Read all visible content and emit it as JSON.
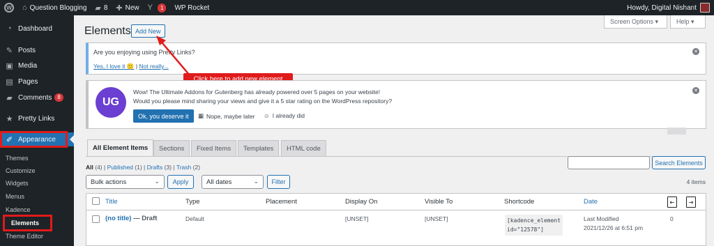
{
  "admin_bar": {
    "site_name": "Question Blogging",
    "comments_count": "8",
    "new_label": "New",
    "yoast_badge": "1",
    "wp_rocket": "WP Rocket",
    "howdy": "Howdy, Digital Nishant"
  },
  "sidebar": {
    "dashboard": "Dashboard",
    "posts": "Posts",
    "media": "Media",
    "pages": "Pages",
    "comments": "Comments",
    "comments_badge": "8",
    "pretty_links": "Pretty Links",
    "appearance": "Appearance",
    "sub": [
      "Themes",
      "Customize",
      "Widgets",
      "Menus",
      "Kadence",
      "Elements",
      "Theme Editor"
    ]
  },
  "screen_options": "Screen Options ▾",
  "help": "Help ▾",
  "page_title": "Elements",
  "add_new": "Add New",
  "callout": "Click here to add new element",
  "notice_pretty": {
    "text": "Are you enjoying using Pretty Links?",
    "yes": "Yes, I love it 🙂",
    "sep": "|",
    "not_really": "Not really..."
  },
  "notice_ug": {
    "logo": "UG",
    "line1": "Wow! The Ultimate Addons for Gutenberg has already powered over 5 pages on your website!",
    "line2": "Would you please mind sharing your views and give it a 5 star rating on the WordPress repository?",
    "ok": "Ok, you deserve it",
    "nope": "Nope, maybe later",
    "already": "I already did"
  },
  "tabs": [
    "All Element Items",
    "Sections",
    "Fixed Items",
    "Templates",
    "HTML code"
  ],
  "subsub": {
    "all": "All",
    "all_count": "(4)",
    "published": "Published",
    "published_count": "(1)",
    "drafts": "Drafts",
    "drafts_count": "(3)",
    "trash": "Trash",
    "trash_count": "(2)"
  },
  "search_button": "Search Elements",
  "bulk_actions": "Bulk actions",
  "apply": "Apply",
  "all_dates": "All dates",
  "filter": "Filter",
  "items_count": "4 items",
  "table": {
    "headers": [
      "Title",
      "Type",
      "Placement",
      "Display On",
      "Visible To",
      "Shortcode",
      "Date"
    ],
    "row": {
      "title": "(no title)",
      "state": " — Draft",
      "type": "Default",
      "placement": "",
      "display_on": "[UNSET]",
      "visible_to": "[UNSET]",
      "shortcode_line1": "[kadence_element",
      "shortcode_line2": "id=\"12578\"]",
      "date_line1": "Last Modified",
      "date_line2": "2021/12/26 at 6:51 pm",
      "count": "0"
    }
  }
}
